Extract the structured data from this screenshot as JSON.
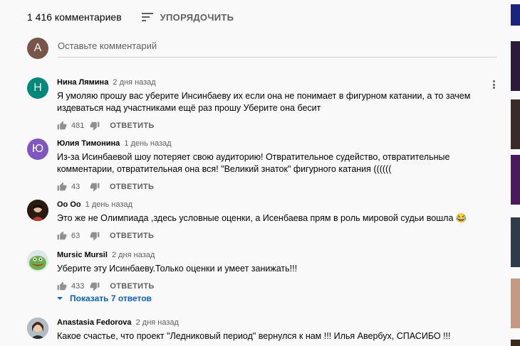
{
  "header": {
    "count": "1 416 комментариев",
    "sort_label": "УПОРЯДОЧИТЬ"
  },
  "add_comment": {
    "avatar_letter": "A",
    "placeholder": "Оставьте комментарий",
    "avatar_color": "#795548"
  },
  "comments": [
    {
      "author": "Нина Лямина",
      "time": "2 дня назад",
      "text": "Я умоляю прошу вас уберите Инсинбаеву их если она не понимает в фигурном катании, а то зачем издеваться над участниками ещё раз прошу Уберите она бесит",
      "likes": "481",
      "reply": "ОТВЕТИТЬ",
      "avatar_letter": "Н",
      "avatar_color": "#00897b"
    },
    {
      "author": "Юлия Тимонина",
      "time": "1 день назад",
      "text": "Из-за Исинбаевой шоу потеряет свою аудиторию! Отвратительное судейство, отвратительные комментарии, отвратительная она  вся! \"Великий знаток\" фигурного катания ((((((",
      "likes": "43",
      "reply": "ОТВЕТИТЬ",
      "avatar_letter": "Ю",
      "avatar_color": "#7e57c2"
    },
    {
      "author": "Оо Оо",
      "time": "1 день назад",
      "text": "Это же не Олимпиада ,здесь условные оценки,  а Исенбаева прям в роль мировой судьи вошла 😂",
      "likes": "63",
      "reply": "ОТВЕТИТЬ"
    },
    {
      "author": "Mursic Mursil",
      "time": "2 дня назад",
      "text": "Уберите эту Исинбаеву.Только оценки и умеет занижать!!!",
      "likes": "433",
      "reply": "ОТВЕТИТЬ"
    },
    {
      "author": "Anastasia Fedorova",
      "time": "2 дня назад",
      "text": "Какое счастье, что проект \"Ледниковый период\" вернулся к нам !!! Илья Авербух, СПАСИБО !!!"
    }
  ],
  "show_replies": "Показать 7 ответов",
  "icons": {
    "sort": "sort-icon",
    "like": "thumb-up-icon",
    "dislike": "thumb-down-icon",
    "more": "more-vert-icon",
    "expand": "arrow-down-icon"
  },
  "colors": {
    "link": "#065fd4",
    "secondary_text": "#606060"
  }
}
